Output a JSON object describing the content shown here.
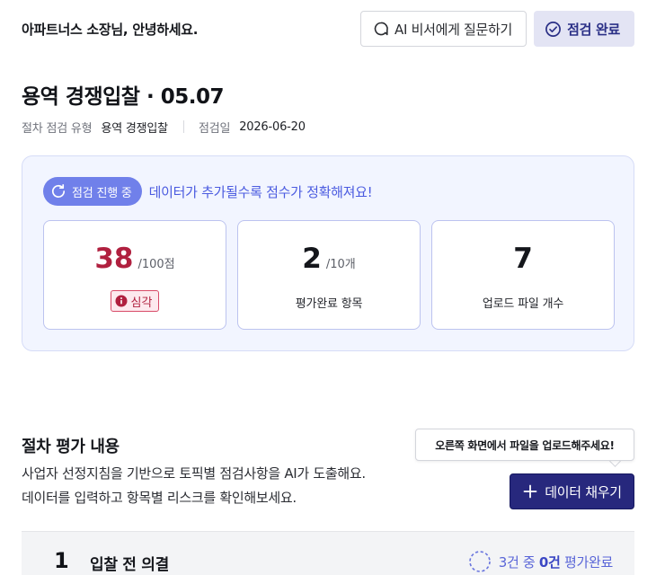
{
  "header": {
    "greeting": "아파트너스 소장님, 안녕하세요.",
    "ask_ai_label": "AI 비서에게 질문하기",
    "complete_label": "점검 완료"
  },
  "page": {
    "title": "용역 경쟁입찰 · 05.07",
    "meta": {
      "type_label": "절차 점검 유형",
      "type_value": "용역 경쟁입찰",
      "date_label": "점검일",
      "date_value": "2026-06-20"
    }
  },
  "summary": {
    "progress_badge": "점검 진행 중",
    "progress_note": "데이터가 추가될수록 점수가 정확해져요!",
    "cards": [
      {
        "value": "38",
        "unit": "/100점",
        "badge": "심각"
      },
      {
        "value": "2",
        "unit": "/10개",
        "label": "평가완료 항목"
      },
      {
        "value": "7",
        "label": "업로드 파일 개수"
      }
    ]
  },
  "section": {
    "title": "절차 평가 내용",
    "description_line1": "사업자 선정지침을 기반으로 토픽별 점검사항을 AI가 도출해요.",
    "description_line2": "데이터를 입력하고 항목별 리스크를 확인해보세요.",
    "tooltip": "오른쪽 화면에서 파일을 업로드해주세요!",
    "fill_button": "데이터 채우기"
  },
  "evaluation_rows": [
    {
      "number": "1",
      "title": "입찰 전 의결",
      "status_prefix": "3건 중 ",
      "status_count": "0건",
      "status_suffix": " 평가완료"
    }
  ],
  "colors": {
    "accent": "#27287d",
    "danger": "#b0203f",
    "progress": "#7080ea",
    "panel_bg": "#f2f5ff"
  },
  "icons": {
    "ask_ai": "chat-bubble-icon",
    "complete": "check-circle-icon",
    "progress": "refresh-icon",
    "severity": "info-icon",
    "fill": "plus-icon",
    "status": "dashed-circle-icon"
  }
}
